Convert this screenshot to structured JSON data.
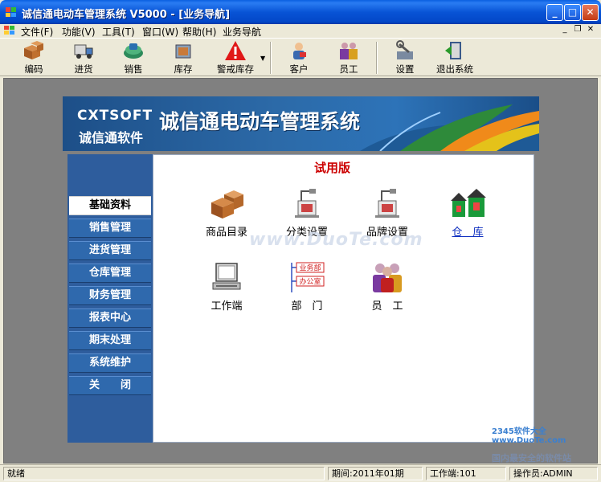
{
  "window": {
    "title": "诚信通电动车管理系统 V5000 - [业务导航]",
    "minimize": "_",
    "maximize": "□",
    "close": "✕"
  },
  "menu": [
    "文件(F)",
    "功能(V)",
    "工具(T)",
    "窗口(W)",
    "帮助(H)",
    "业务导航"
  ],
  "mdi": {
    "minimize": "_",
    "restore": "❐",
    "close": "✕"
  },
  "toolbar": [
    {
      "label": "编码",
      "icon": "boxes-icon"
    },
    {
      "label": "进货",
      "icon": "truck-icon"
    },
    {
      "label": "销售",
      "icon": "sales-icon"
    },
    {
      "label": "库存",
      "icon": "warehouse-icon"
    },
    {
      "label": "警戒库存",
      "icon": "warning-icon"
    },
    {
      "label": "客户",
      "icon": "customer-icon"
    },
    {
      "label": "员工",
      "icon": "staff-icon"
    },
    {
      "label": "设置",
      "icon": "settings-icon"
    },
    {
      "label": "退出系统",
      "icon": "exit-icon"
    }
  ],
  "banner": {
    "brand_en": "CXTSOFT",
    "brand_cn": "诚信通软件",
    "title": "诚信通电动车管理系统"
  },
  "nav": [
    {
      "label": "基础资料",
      "active": true
    },
    {
      "label": "销售管理"
    },
    {
      "label": "进货管理"
    },
    {
      "label": "仓库管理"
    },
    {
      "label": "财务管理"
    },
    {
      "label": "报表中心"
    },
    {
      "label": "期末处理"
    },
    {
      "label": "系统维护"
    },
    {
      "label": "关　　闭"
    }
  ],
  "content": {
    "trial": "试用版",
    "shortcuts": [
      {
        "label": "商品目录",
        "icon": "product-catalog-icon"
      },
      {
        "label": "分类设置",
        "icon": "category-icon"
      },
      {
        "label": "品牌设置",
        "icon": "brand-icon"
      },
      {
        "label": "仓　库",
        "icon": "warehouse-house-icon"
      },
      {
        "label": "工作端",
        "icon": "workstation-icon"
      },
      {
        "label": "部　门",
        "icon": "department-icon"
      },
      {
        "label": "员　工",
        "icon": "employee-icon"
      }
    ],
    "dept_tags": [
      "业务部",
      "办公室"
    ]
  },
  "watermark": {
    "main": "www.DuoTe.com",
    "site": "2345软件大全 www.DuoTe.com",
    "slogan": "国内最安全的软件站"
  },
  "status": {
    "ready": "就绪",
    "period": "期间:2011年01期",
    "terminal": "工作端:101",
    "operator": "操作员:ADMIN"
  }
}
